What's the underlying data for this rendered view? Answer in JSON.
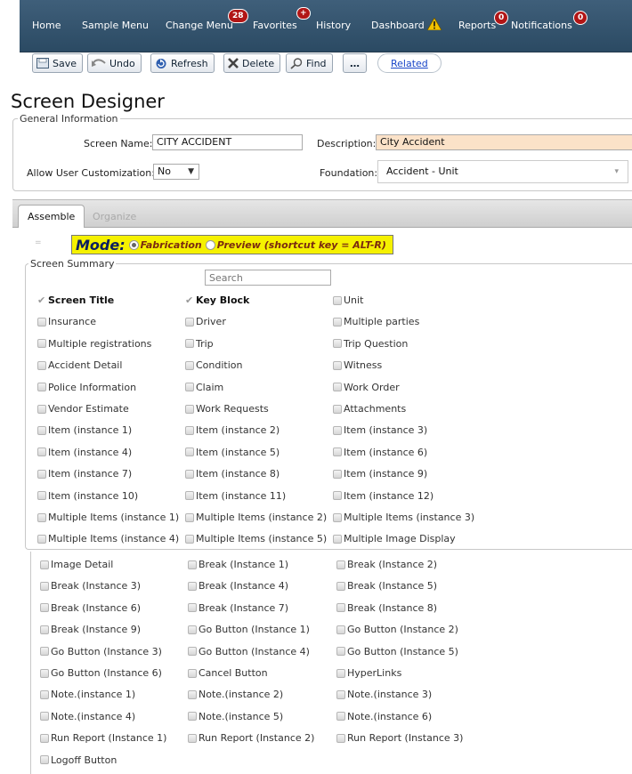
{
  "nav": {
    "items": [
      "Home",
      "Sample Menu",
      "Change Menu",
      "Favorites",
      "History",
      "Dashboard",
      "Reports",
      "Notifications"
    ],
    "badges": {
      "change_menu": "28",
      "favorites": "+",
      "reports": "0",
      "notifications": "0"
    },
    "colors": {
      "bar": "#2b4a63",
      "badge": "#b11616",
      "warning": "#f2c200"
    }
  },
  "toolbar": {
    "save": "Save",
    "undo": "Undo",
    "refresh": "Refresh",
    "delete": "Delete",
    "find": "Find",
    "more": "…",
    "related": "Related"
  },
  "page": {
    "title": "Screen Designer"
  },
  "general": {
    "legend": "General Information",
    "screen_name_label": "Screen Name:",
    "screen_name_value": "CITY ACCIDENT",
    "description_label": "Description:",
    "description_value": "City Accident",
    "customization_label": "Allow User Customization:",
    "customization_value": "No",
    "foundation_label": "Foundation:",
    "foundation_value": "Accident - Unit"
  },
  "tabs": {
    "assemble": "Assemble",
    "organize": "Organize"
  },
  "mode": {
    "label": "Mode:",
    "fabrication": "Fabrication",
    "preview": "Preview (shortcut key = ALT-R)",
    "selected": "Fabrication"
  },
  "summary": {
    "legend": "Screen Summary",
    "search_placeholder": "Search",
    "items": [
      [
        "Screen Title",
        "Key Block",
        "Unit"
      ],
      [
        "Insurance",
        "Driver",
        "Multiple parties"
      ],
      [
        "Multiple registrations",
        "Trip",
        "Trip Question"
      ],
      [
        "Accident Detail",
        "Condition",
        "Witness"
      ],
      [
        "Police Information",
        "Claim",
        "Work Order"
      ],
      [
        "Vendor Estimate",
        "Work Requests",
        "Attachments"
      ],
      [
        "Item (instance 1)",
        "Item (instance 2)",
        "Item (instance 3)"
      ],
      [
        "Item (instance 4)",
        "Item (instance 5)",
        "Item (instance 6)"
      ],
      [
        "Item (instance 7)",
        "Item (instance 8)",
        "Item (instance 9)"
      ],
      [
        "Item (instance 10)",
        "Item (instance 11)",
        "Item (instance 12)"
      ],
      [
        "Multiple Items (instance 1)",
        "Multiple Items (instance 2)",
        "Multiple Items (instance 3)"
      ],
      [
        "Multiple Items (instance 4)",
        "Multiple Items (instance 5)",
        "Multiple Image Display"
      ]
    ],
    "checked": [
      "Screen Title",
      "Key Block"
    ]
  },
  "components": {
    "items": [
      [
        "Image Detail",
        "Break (Instance 1)",
        "Break (Instance 2)"
      ],
      [
        "Break (Instance 3)",
        "Break (Instance 4)",
        "Break (Instance 5)"
      ],
      [
        "Break (Instance 6)",
        "Break (Instance 7)",
        "Break (Instance 8)"
      ],
      [
        "Break (Instance 9)",
        "Go Button (Instance 1)",
        "Go Button (Instance 2)"
      ],
      [
        "Go Button (Instance 3)",
        "Go Button (Instance 4)",
        "Go Button (Instance 5)"
      ],
      [
        "Go Button (Instance 6)",
        "Cancel Button",
        "HyperLinks"
      ],
      [
        "Note.(instance 1)",
        "Note.(instance 2)",
        "Note.(instance 3)"
      ],
      [
        "Note.(instance 4)",
        "Note.(instance 5)",
        "Note.(instance 6)"
      ],
      [
        "Run Report (Instance 1)",
        "Run Report (Instance 2)",
        "Run Report (Instance 3)"
      ],
      [
        "Logoff Button"
      ]
    ]
  }
}
